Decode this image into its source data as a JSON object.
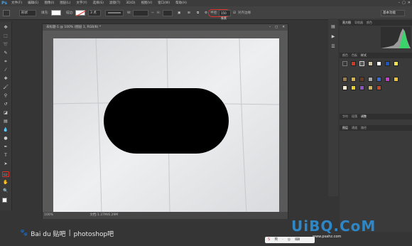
{
  "app": {
    "logo": "Ps"
  },
  "menubar": {
    "items": [
      "文件(F)",
      "编辑(E)",
      "图像(I)",
      "图层(L)",
      "文字(Y)",
      "选择(S)",
      "滤镜(T)",
      "3D(D)",
      "视图(V)",
      "窗口(W)",
      "帮助(H)"
    ],
    "window_controls": [
      "–",
      "▢",
      "✕"
    ]
  },
  "options": {
    "shape_mode": "形状",
    "fill_label": "填充:",
    "stroke_label": "描边:",
    "stroke_size": "3 点",
    "w_label": "W:",
    "h_label": "H:",
    "radius_label": "半径:",
    "radius_value": "150 像素",
    "align_edges_label": "对齐边缘",
    "workspace": "基本功能"
  },
  "document": {
    "title": "未标题-1 @ 100% (图层 1, RGB/8) *",
    "controls": [
      "–",
      "▢",
      "✕"
    ],
    "zoom": "100%",
    "doc_size": "文档:1.37M/6.29M"
  },
  "panels": {
    "top_tabs": [
      "直方图",
      "导航器",
      "颜色"
    ],
    "styles_tabs": [
      "颜色",
      "色板",
      "样式"
    ],
    "middle_tabs": [
      "字符",
      "段落",
      "调整"
    ],
    "layers_tabs": [
      "图层",
      "通道",
      "路径"
    ]
  },
  "colors": {
    "accent": "#31a8ff",
    "highlight": "#e0312a",
    "canvas": "#e3e4e6",
    "shape": "#000000"
  },
  "watermarks": {
    "left_brand": "Bai du 贴吧",
    "left_sep": "|",
    "left_text": "photoshop吧",
    "right_logo": "UiBQ.CoM",
    "right_url": "www.psahz.com"
  },
  "ime": {
    "items": [
      "S",
      "英",
      "·",
      "◎",
      "⌨"
    ]
  }
}
